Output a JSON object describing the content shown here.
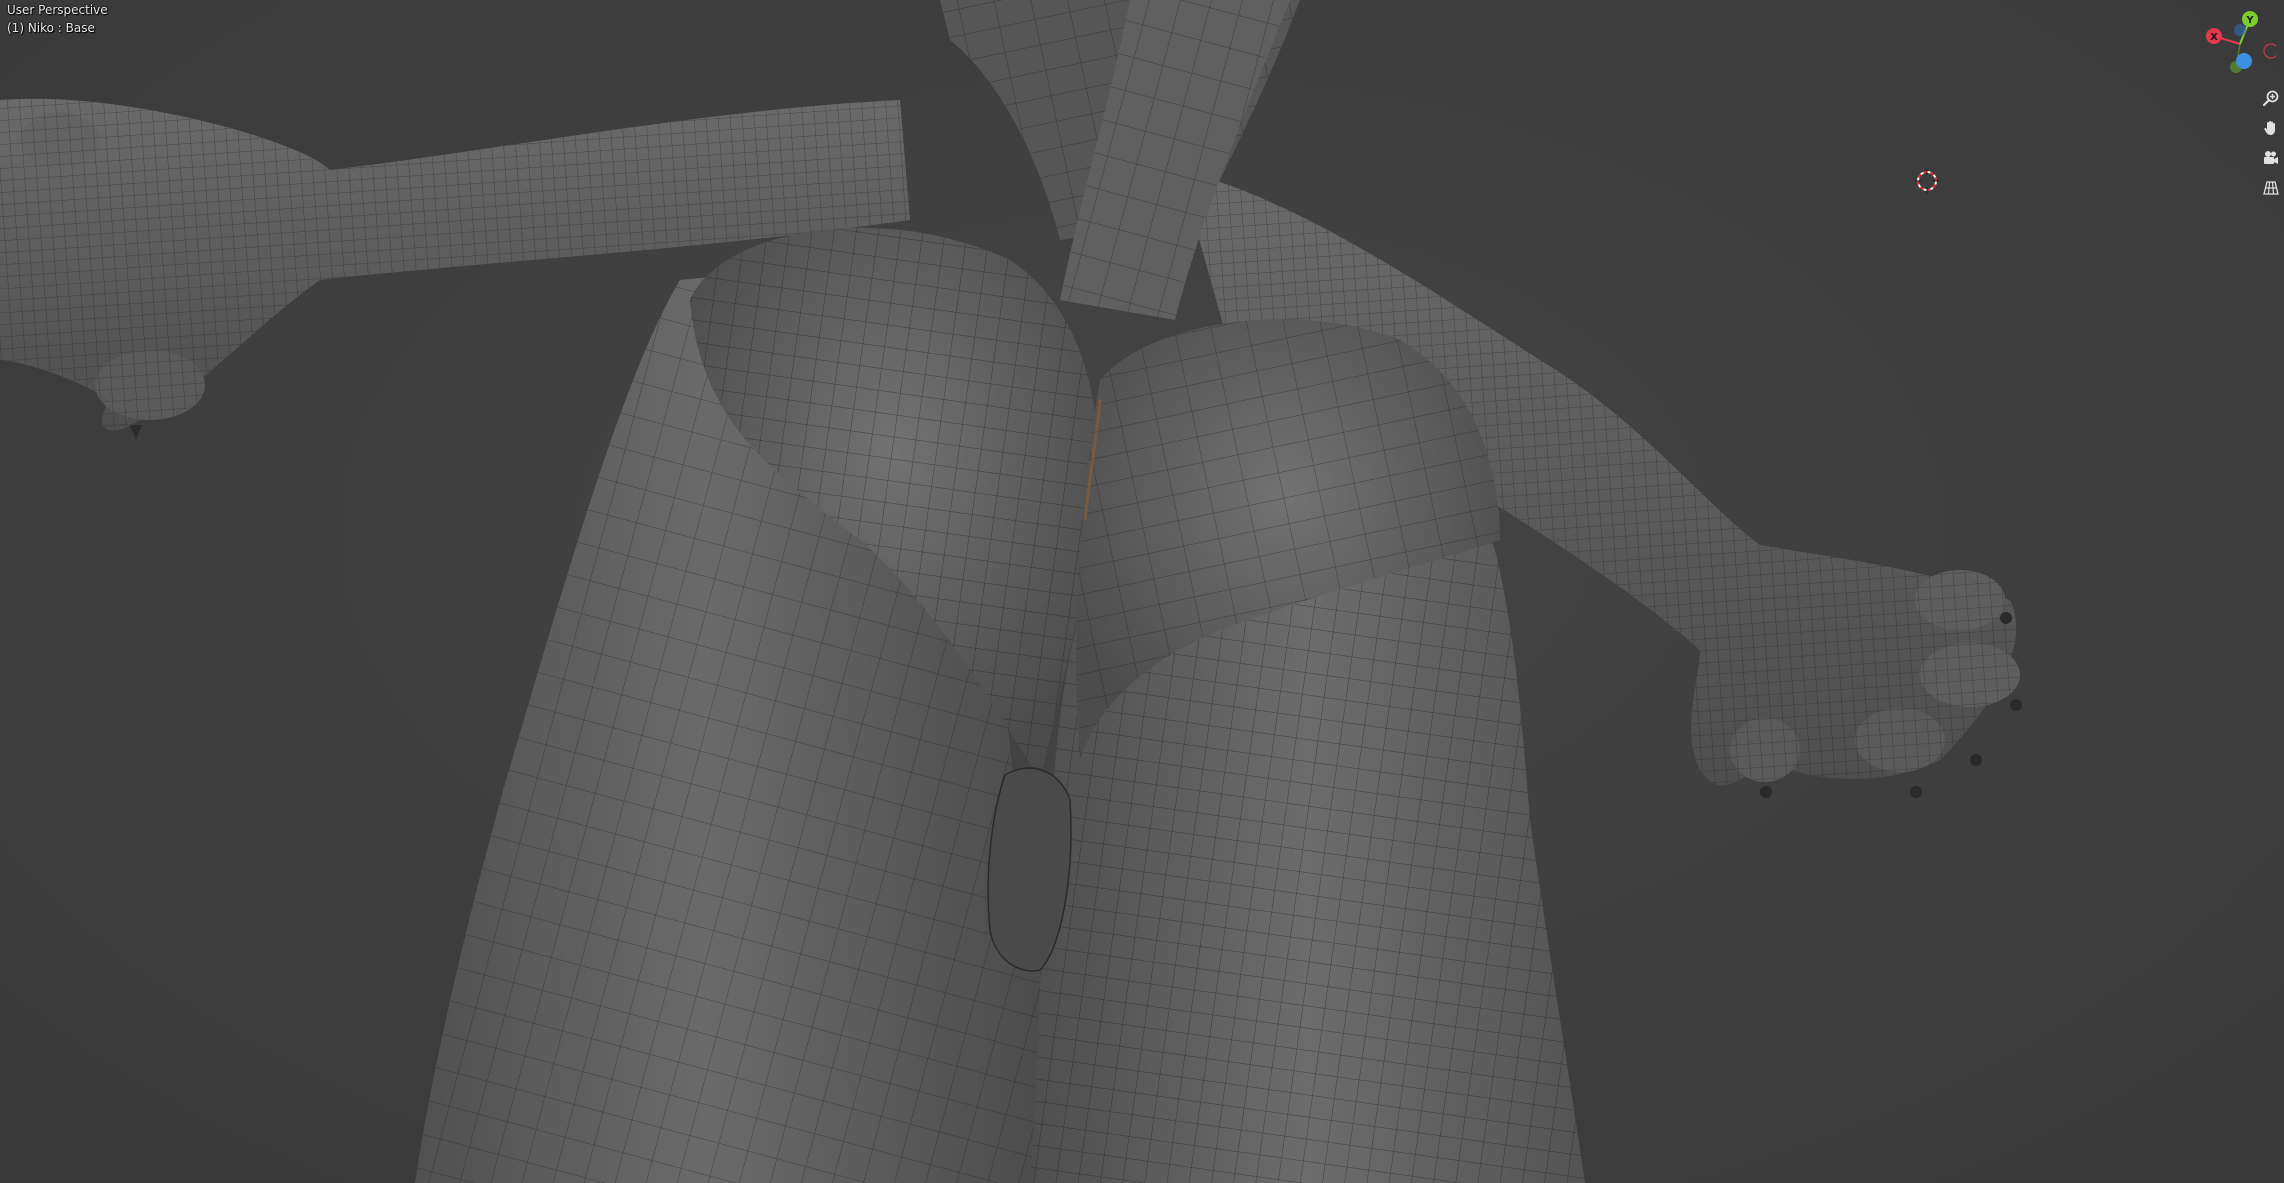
{
  "viewport": {
    "perspective_label": "User Perspective",
    "object_label": "(1) Niko : Base"
  },
  "gizmo": {
    "axes": [
      {
        "name": "X",
        "color": "#e5394d"
      },
      {
        "name": "Y",
        "color": "#7ccf2b"
      },
      {
        "name": "Z",
        "color": "#3d8fe0"
      }
    ]
  },
  "nav_buttons": [
    {
      "name": "zoom",
      "icon": "magnifier-plus-icon"
    },
    {
      "name": "pan",
      "icon": "hand-icon"
    },
    {
      "name": "camera",
      "icon": "camera-icon"
    },
    {
      "name": "ortho",
      "icon": "grid-icon"
    }
  ],
  "theme": {
    "background": "#3d3d3d",
    "mesh": "#6e6e6e",
    "wire": "#1e1e1e",
    "text": "#e6e6e6"
  }
}
